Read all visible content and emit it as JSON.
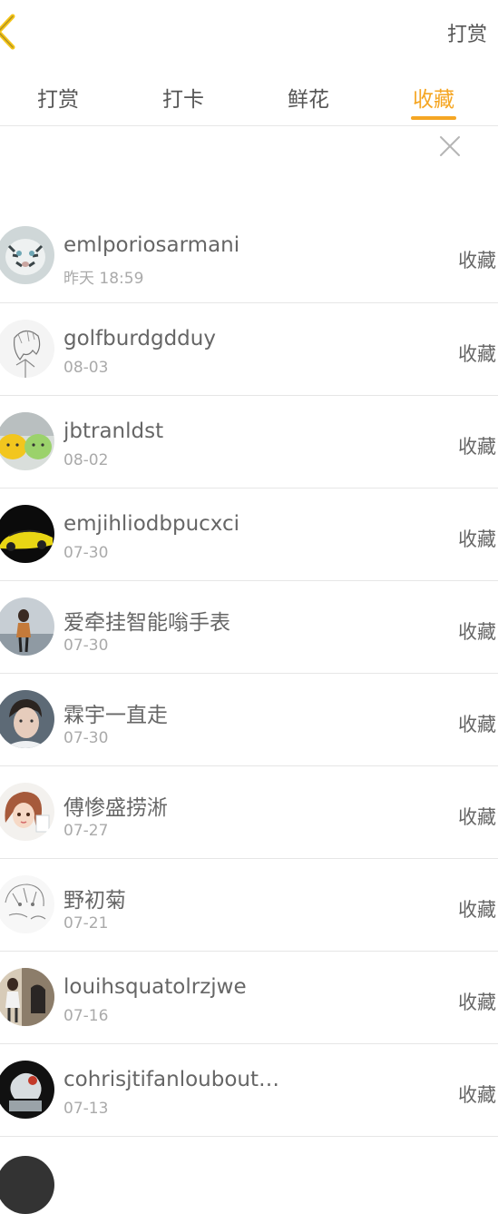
{
  "header": {
    "right_label": "打赏"
  },
  "tabs": [
    {
      "label": "打赏",
      "active": false
    },
    {
      "label": "打卡",
      "active": false
    },
    {
      "label": "鲜花",
      "active": false
    },
    {
      "label": "收藏",
      "active": true
    }
  ],
  "colors": {
    "accent": "#f5a623",
    "text": "#666666",
    "subtext": "#aaaaaa",
    "divider": "#e6e6e6"
  },
  "icons": {
    "back": "chevron-left-icon",
    "close": "close-icon"
  },
  "users": [
    {
      "name": "emlporiosarmani",
      "time": "昨天 18:59",
      "action": "收藏"
    },
    {
      "name": "golfburdgdduy",
      "time": "08-03",
      "action": "收藏"
    },
    {
      "name": "jbtranldst",
      "time": "08-02",
      "action": "收藏"
    },
    {
      "name": "emjihliodbpucxci",
      "time": "07-30",
      "action": "收藏"
    },
    {
      "name": "爱牵挂智能嗡手表",
      "time": "07-30",
      "action": "收藏"
    },
    {
      "name": "霖宇一直走",
      "time": "07-30",
      "action": "收藏"
    },
    {
      "name": "傅惨盛捞淅",
      "time": "07-27",
      "action": "收藏"
    },
    {
      "name": "野初菊",
      "time": "07-21",
      "action": "收藏"
    },
    {
      "name": "louihsquatolrzjwe",
      "time": "07-16",
      "action": "收藏"
    },
    {
      "name": "cohrisjtifanloubout…",
      "time": "07-13",
      "action": "收藏"
    }
  ]
}
